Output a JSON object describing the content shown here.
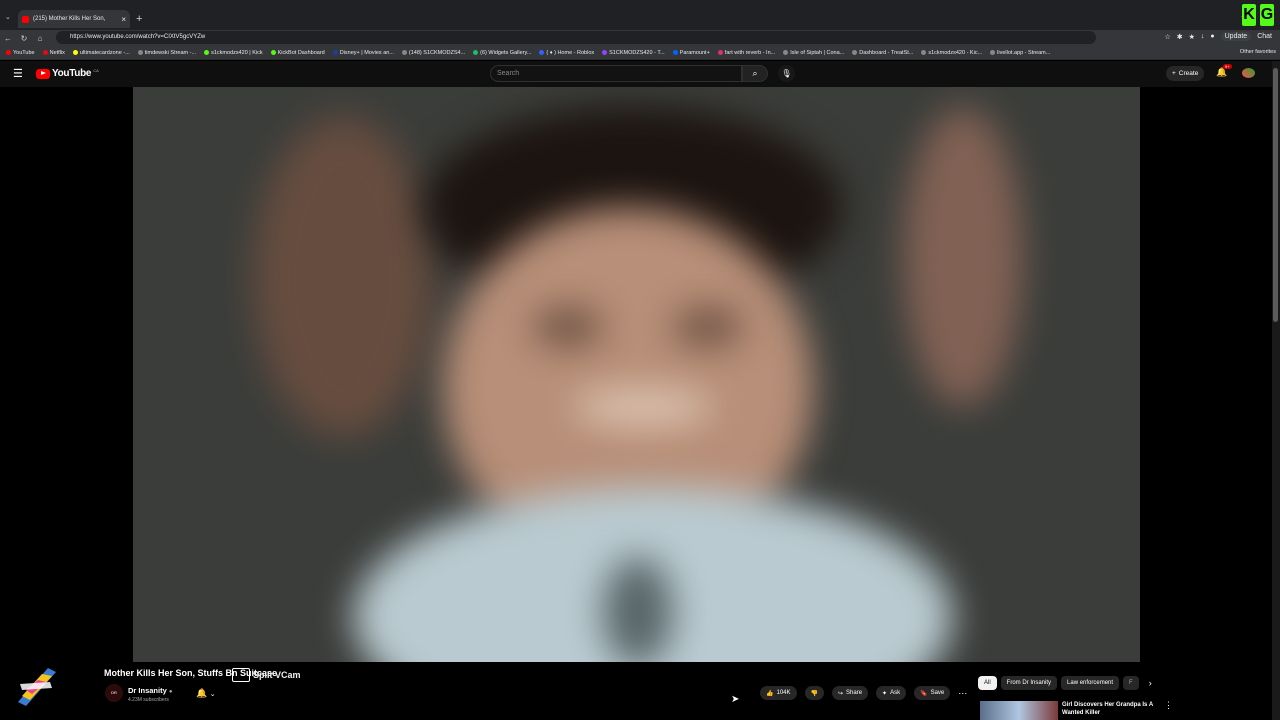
{
  "browser": {
    "tab_title": "(215) Mother Kills Her Son,",
    "url": "https://www.youtube.com/watch?v=CIXtV5gcVYZw",
    "update_label": "Update",
    "chat_label": "Chat",
    "bookmarks": [
      "YouTube",
      "Netflix",
      "ultimatecardzone -...",
      "timdewski Stream -...",
      "s1ckmodzs420 | Kick",
      "KickBot Dashboard",
      "Disney+ | Movies an...",
      "(148) S1CKMODZS4...",
      "(6) Widgets Gallery...",
      "( ♦ ) Home - Roblox",
      "S1CKMODZS420 - T...",
      "Paramount+",
      "fart with reverb - In...",
      "Isle of Siptah | Cona...",
      "Dashboard - TreatSt...",
      "s1ckmodzs420 - Kic...",
      "livellot.app - Stream..."
    ],
    "other_favorites": "Other favorites"
  },
  "youtube": {
    "logo_text": "YouTube",
    "country": "CA",
    "search_placeholder": "Search",
    "create_label": "Create",
    "notif_badge": "9+"
  },
  "video": {
    "title": "Mother Kills Her Son, Stuffs B",
    "title_tail": "n Suitcase",
    "vcam_label": "Split VCam",
    "channel": "Dr Insanity",
    "channel_avatar_text": "DR",
    "subscribers": "4.23M subscribers",
    "likes": "104K",
    "share_label": "Share",
    "ask_label": "Ask",
    "save_label": "Save"
  },
  "chips": [
    "All",
    "From Dr Insanity",
    "Law enforcement",
    "F"
  ],
  "recommendation": {
    "title": "Girl Discovers Her Grandpa Is A Wanted Killer"
  }
}
